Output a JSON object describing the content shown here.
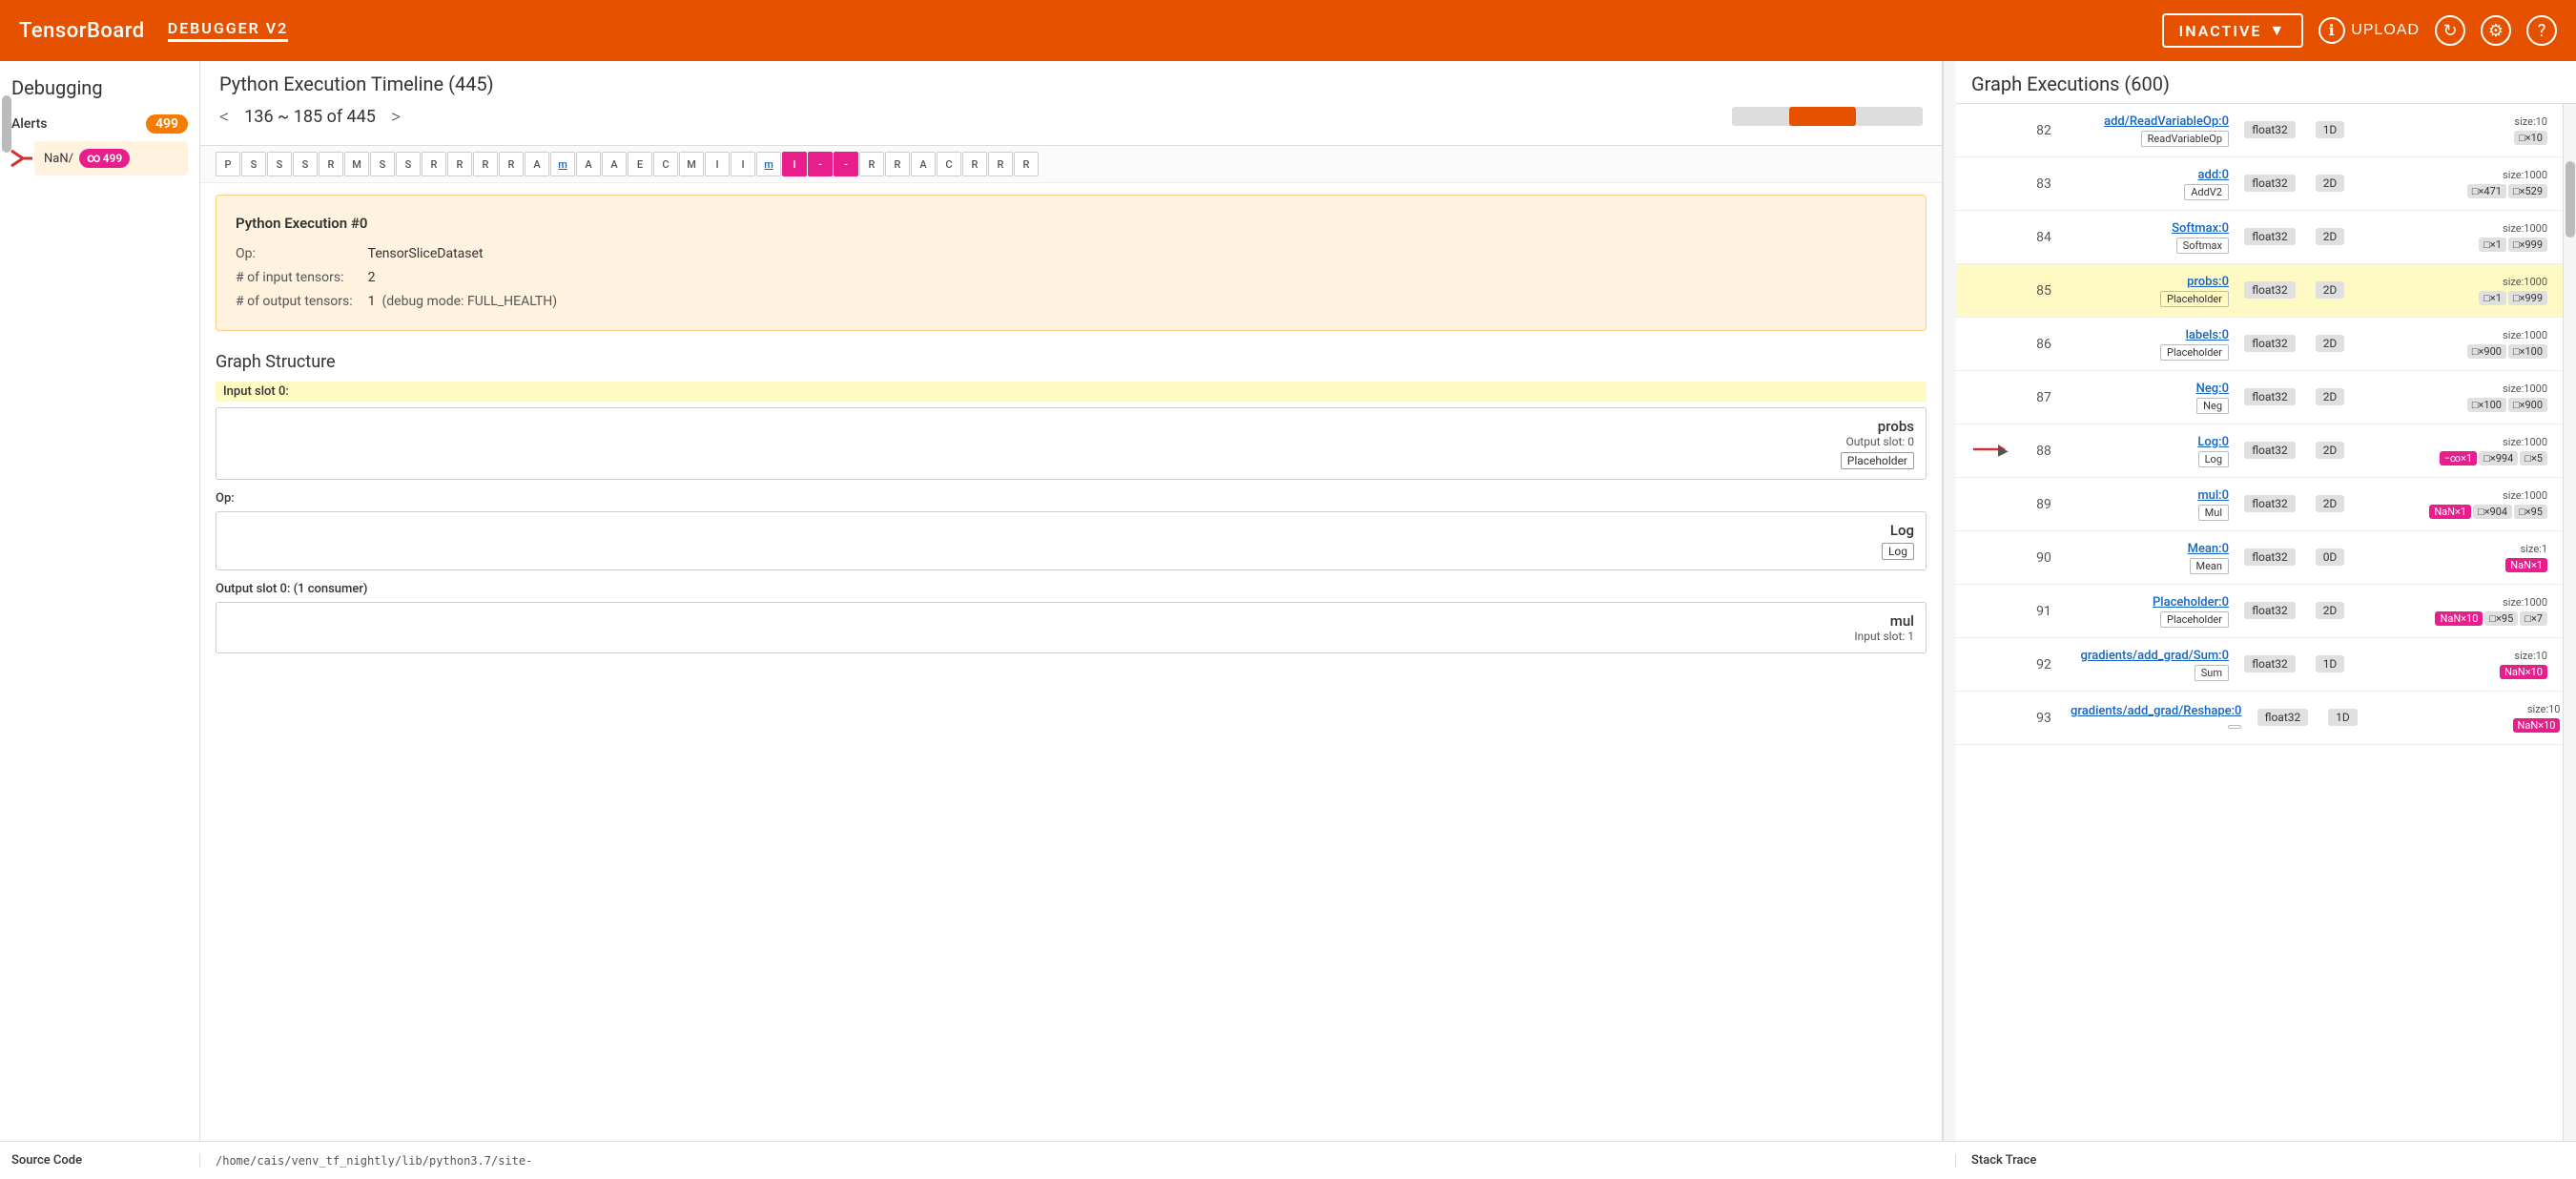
{
  "app": {
    "brand": "TensorBoard",
    "plugin": "DEBUGGER V2",
    "status": "INACTIVE",
    "upload_label": "UPLOAD"
  },
  "sidebar": {
    "title": "Debugging",
    "alerts_label": "Alerts",
    "alerts_count": "499",
    "nan_label": "NaN/",
    "nan_count": "499"
  },
  "python_timeline": {
    "title": "Python Execution Timeline (445)",
    "range_text": "136 ~ 185 of 445",
    "chips": [
      {
        "label": "P",
        "type": "default"
      },
      {
        "label": "S",
        "type": "default"
      },
      {
        "label": "S",
        "type": "default"
      },
      {
        "label": "S",
        "type": "default"
      },
      {
        "label": "R",
        "type": "default"
      },
      {
        "label": "M",
        "type": "default"
      },
      {
        "label": "S",
        "type": "default"
      },
      {
        "label": "S",
        "type": "default"
      },
      {
        "label": "R",
        "type": "default"
      },
      {
        "label": "R",
        "type": "default"
      },
      {
        "label": "R",
        "type": "default"
      },
      {
        "label": "R",
        "type": "default"
      },
      {
        "label": "A",
        "type": "default"
      },
      {
        "label": "m",
        "type": "underline"
      },
      {
        "label": "A",
        "type": "default"
      },
      {
        "label": "A",
        "type": "default"
      },
      {
        "label": "E",
        "type": "default"
      },
      {
        "label": "C",
        "type": "default"
      },
      {
        "label": "M",
        "type": "default"
      },
      {
        "label": "I",
        "type": "default"
      },
      {
        "label": "I",
        "type": "default"
      },
      {
        "label": "m",
        "type": "underline"
      },
      {
        "label": "I",
        "type": "highlight"
      },
      {
        "label": "-",
        "type": "highlight"
      },
      {
        "label": "-",
        "type": "highlight"
      },
      {
        "label": "R",
        "type": "default"
      },
      {
        "label": "R",
        "type": "default"
      },
      {
        "label": "A",
        "type": "default"
      },
      {
        "label": "C",
        "type": "default"
      },
      {
        "label": "R",
        "type": "default"
      },
      {
        "label": "R",
        "type": "default"
      },
      {
        "label": "R",
        "type": "default"
      }
    ]
  },
  "exec_info": {
    "title": "Python Execution #0",
    "op_label": "Op:",
    "op_value": "TensorSliceDataset",
    "input_tensors_label": "# of input tensors:",
    "input_tensors_value": "2",
    "output_tensors_label": "# of output tensors:",
    "output_tensors_value": "1",
    "debug_mode_label": "(debug mode: FULL_HEALTH)"
  },
  "graph_structure": {
    "title": "Graph Structure",
    "input_slot_label": "Input slot 0:",
    "input_slot_name": "probs",
    "input_slot_sub": "Output slot: 0",
    "input_slot_tag": "Placeholder",
    "op_label": "Op:",
    "op_name": "Log",
    "op_tag": "Log",
    "output_slot_label": "Output slot 0: (1 consumer)",
    "output_slot_name": "mul",
    "output_slot_sub": "Input slot: 1"
  },
  "graph_executions": {
    "title": "Graph Executions (600)",
    "rows": [
      {
        "num": "82",
        "has_arrow": false,
        "op_name": "add/ReadVariableOp:0",
        "op_tag": "ReadVariableOp",
        "dtype": "float32",
        "dim": "1D",
        "size_label": "size:10",
        "size_chips": [
          {
            "label": "□×10",
            "type": "normal"
          }
        ]
      },
      {
        "num": "83",
        "has_arrow": false,
        "op_name": "add:0",
        "op_tag": "AddV2",
        "dtype": "float32",
        "dim": "2D",
        "size_label": "size:1000",
        "size_chips": [
          {
            "label": "□×471",
            "type": "normal"
          },
          {
            "label": "□×529",
            "type": "normal"
          }
        ]
      },
      {
        "num": "84",
        "has_arrow": false,
        "op_name": "Softmax:0",
        "op_tag": "Softmax",
        "dtype": "float32",
        "dim": "2D",
        "size_label": "size:1000",
        "size_chips": [
          {
            "label": "□×1",
            "type": "normal"
          },
          {
            "label": "□×999",
            "type": "normal"
          }
        ]
      },
      {
        "num": "85",
        "has_arrow": false,
        "highlighted": true,
        "op_name": "probs:0",
        "op_tag": "Placeholder",
        "dtype": "float32",
        "dim": "2D",
        "size_label": "size:1000",
        "size_chips": [
          {
            "label": "□×1",
            "type": "normal"
          },
          {
            "label": "□×999",
            "type": "normal"
          }
        ]
      },
      {
        "num": "86",
        "has_arrow": false,
        "op_name": "labels:0",
        "op_tag": "Placeholder",
        "dtype": "float32",
        "dim": "2D",
        "size_label": "size:1000",
        "size_chips": [
          {
            "label": "□×900",
            "type": "normal"
          },
          {
            "label": "□×100",
            "type": "normal"
          }
        ]
      },
      {
        "num": "87",
        "has_arrow": false,
        "op_name": "Neg:0",
        "op_tag": "Neg",
        "dtype": "float32",
        "dim": "2D",
        "size_label": "size:1000",
        "size_chips": [
          {
            "label": "□×100",
            "type": "normal"
          },
          {
            "label": "□×900",
            "type": "normal"
          }
        ]
      },
      {
        "num": "88",
        "has_arrow": true,
        "op_name": "Log:0",
        "op_tag": "Log",
        "dtype": "float32",
        "dim": "2D",
        "size_label": "size:1000",
        "size_chips": [
          {
            "label": "−∞×1",
            "type": "nan"
          },
          {
            "label": "□×994",
            "type": "normal"
          },
          {
            "label": "□×5",
            "type": "normal"
          }
        ]
      },
      {
        "num": "89",
        "has_arrow": false,
        "op_name": "mul:0",
        "op_tag": "Mul",
        "dtype": "float32",
        "dim": "2D",
        "size_label": "size:1000",
        "size_chips": [
          {
            "label": "NaN×1",
            "type": "nan"
          },
          {
            "label": "□×904",
            "type": "normal"
          },
          {
            "label": "□×95",
            "type": "normal"
          }
        ]
      },
      {
        "num": "90",
        "has_arrow": false,
        "op_name": "Mean:0",
        "op_tag": "Mean",
        "dtype": "float32",
        "dim": "0D",
        "size_label": "size:1",
        "size_chips": [
          {
            "label": "NaN×1",
            "type": "nan"
          }
        ]
      },
      {
        "num": "91",
        "has_arrow": false,
        "op_name": "Placeholder:0",
        "op_tag": "Placeholder",
        "dtype": "float32",
        "dim": "2D",
        "size_label": "size:1000",
        "size_chips": [
          {
            "label": "NaN×10",
            "type": "nan"
          },
          {
            "label": "□×95",
            "type": "normal"
          },
          {
            "label": "□×7",
            "type": "normal"
          }
        ]
      },
      {
        "num": "92",
        "has_arrow": false,
        "op_name": "gradients/add_grad/Sum:0",
        "op_tag": "Sum",
        "dtype": "float32",
        "dim": "1D",
        "size_label": "size:10",
        "size_chips": [
          {
            "label": "NaN×10",
            "type": "nan"
          }
        ]
      },
      {
        "num": "93",
        "has_arrow": false,
        "op_name": "gradients/add_grad/Reshape:0",
        "op_tag": "",
        "dtype": "float32",
        "dim": "1D",
        "size_label": "size:10",
        "size_chips": [
          {
            "label": "NaN×10",
            "type": "nan"
          }
        ]
      }
    ]
  },
  "bottom": {
    "source_label": "Source Code",
    "source_path": "/home/cais/venv_tf_nightly/lib/python3.7/site-",
    "stack_label": "Stack Trace"
  }
}
